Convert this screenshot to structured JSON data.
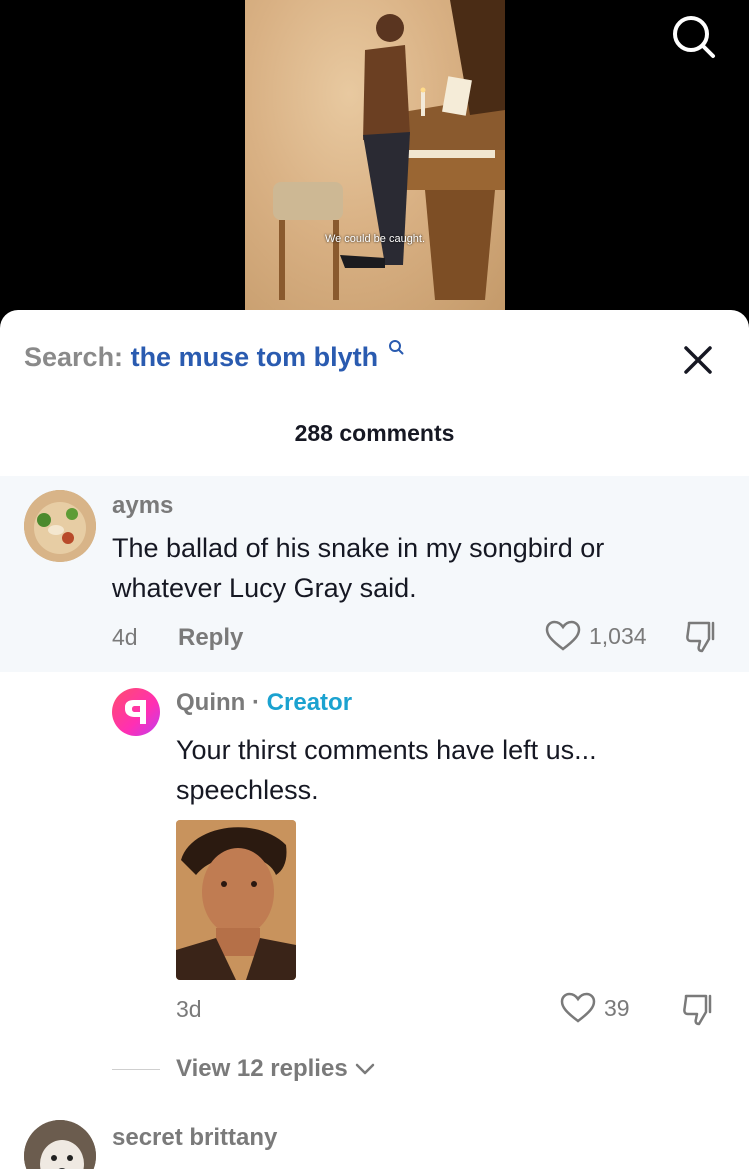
{
  "video": {
    "caption": "We could be caught."
  },
  "header": {
    "search_label": "Search:",
    "search_term": "the muse tom blyth"
  },
  "comments_count": "288 comments",
  "comments": [
    {
      "username": "ayms",
      "text_line1": "The ballad of his snake in my songbird or",
      "text_line2": "whatever Lucy Gray said.",
      "time": "4d",
      "reply_label": "Reply",
      "likes": "1,034"
    }
  ],
  "reply": {
    "username": "Quinn",
    "separator": "·",
    "badge": "Creator",
    "text_line1": "Your thirst comments have left us...",
    "text_line2": "speechless.",
    "time": "3d",
    "likes": "39"
  },
  "view_replies": "View 12 replies",
  "next_comment": {
    "username": "secret brittany"
  },
  "colors": {
    "accent_blue": "#2a5bb0",
    "creator_cyan": "#1ba2d0",
    "highlight_bg": "#f5f8fb"
  }
}
